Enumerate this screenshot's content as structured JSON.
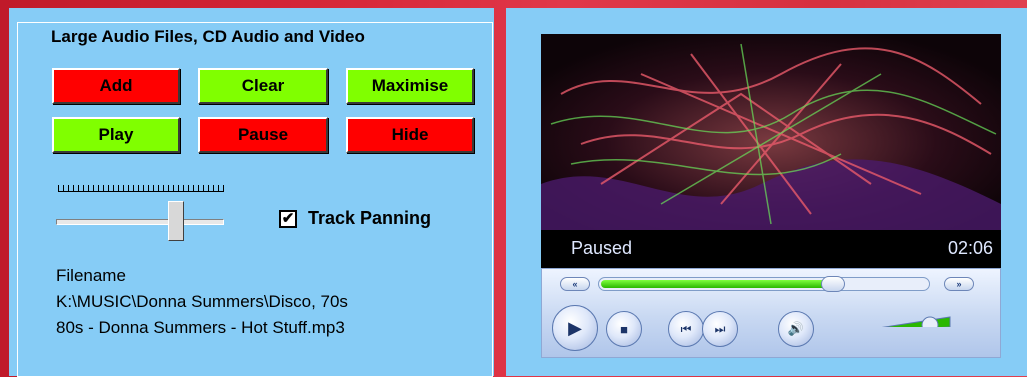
{
  "left_panel": {
    "title": "Large Audio Files, CD Audio and Video",
    "buttons": {
      "add": "Add",
      "clear": "Clear",
      "maximise": "Maximise",
      "play": "Play",
      "pause": "Pause",
      "hide": "Hide"
    },
    "track_panning": {
      "label": "Track Panning",
      "checked": true,
      "check_glyph": "✔"
    },
    "filename": {
      "caption": "Filename",
      "line1": "K:\\MUSIC\\Donna Summers\\Disco, 70s",
      "line2": "80s - Donna Summers - Hot Stuff.mp3"
    }
  },
  "player": {
    "status": "Paused",
    "time": "02:06",
    "seek_progress": 0.72,
    "volume_level": 0.85,
    "icons": {
      "rewind_pill": "«",
      "forward_pill": "»",
      "play": "▶",
      "stop": "■",
      "previous": "⏮",
      "next": "⏭",
      "mute": "🔊"
    }
  },
  "colors": {
    "panel": "#86ccf6",
    "button_red": "#ff0000",
    "button_green": "#80ff00"
  }
}
